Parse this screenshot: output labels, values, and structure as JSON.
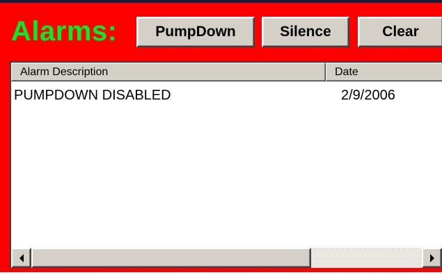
{
  "header": {
    "title": "Alarms:"
  },
  "toolbar": {
    "pumpdown_label": "PumpDown",
    "silence_label": "Silence",
    "clear_label": "Clear"
  },
  "alarm_list": {
    "columns": [
      "Alarm Description",
      "Date"
    ],
    "rows": [
      {
        "description": "PUMPDOWN DISABLED",
        "date": "2/9/2006"
      }
    ]
  },
  "colors": {
    "panel_background": "#ff0000",
    "title_text": "#00ee22",
    "button_face": "#d4d0c8"
  },
  "icons": {
    "scroll_left": "triangle-left-icon",
    "scroll_right": "triangle-right-icon"
  }
}
